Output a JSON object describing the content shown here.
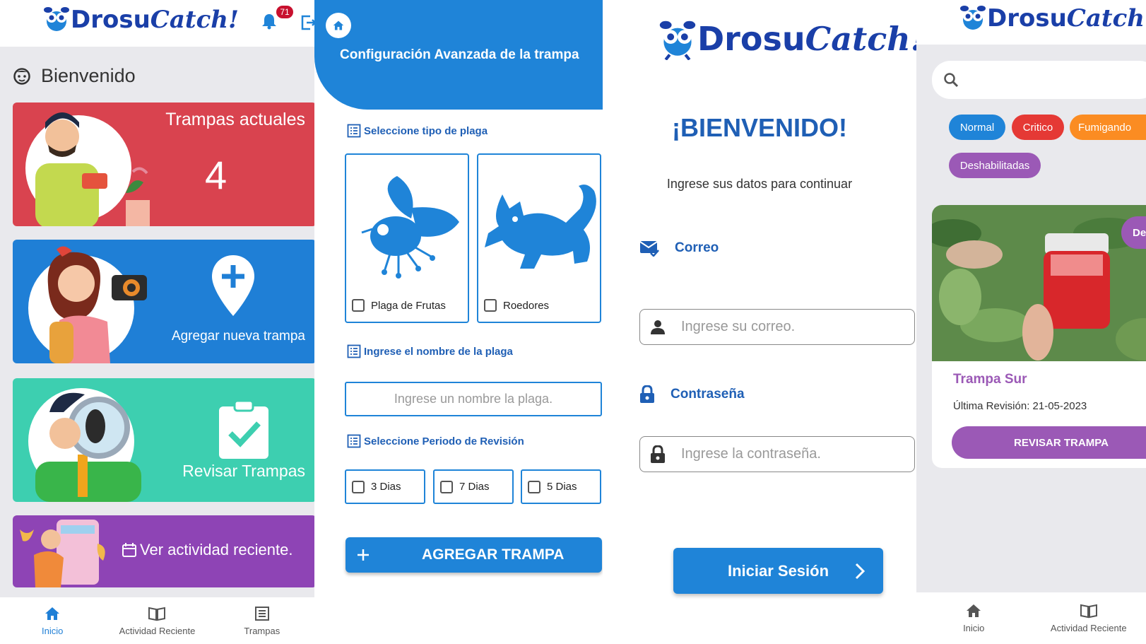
{
  "brand": {
    "logo_part1": "Drosu",
    "logo_part2": "Catch!",
    "primary_blue": "#1f84d8",
    "dark_blue": "#1f5fb5"
  },
  "home": {
    "notification_count": "71",
    "welcome": "Bienvenido",
    "cards": {
      "current_traps_title": "Trampas actuales",
      "current_traps_count": "4",
      "add_trap": "Agregar nueva trampa",
      "review_traps": "Revisar Trampas",
      "recent_activity": "Ver actividad reciente."
    },
    "nav": {
      "home": "Inicio",
      "activity": "Actividad Reciente",
      "traps": "Trampas"
    },
    "colors": {
      "red_card": "#d9434f",
      "blue_card": "#1f7fd6",
      "teal_card": "#3dcfb0",
      "purple_card": "#8e44b5"
    }
  },
  "config": {
    "title": "Configuración Avanzada de la trampa",
    "section_pest_type": "Seleccione tipo de plaga",
    "pest_options": [
      "Plaga de Frutas",
      "Roedores"
    ],
    "section_pest_name": "Ingrese el nombre de la plaga",
    "pest_name_placeholder": "Ingrese un nombre la plaga.",
    "section_period": "Seleccione Periodo de Revisión",
    "period_options": [
      "3 Dias",
      "7 Dias",
      "5 Dias"
    ],
    "add_button": "AGREGAR TRAMPA"
  },
  "login": {
    "title": "¡BIENVENIDO!",
    "subtitle": "Ingrese sus datos para continuar",
    "email_label": "Correo",
    "email_placeholder": "Ingrese su correo.",
    "password_label": "Contraseña",
    "password_placeholder": "Ingrese la contraseña.",
    "login_button": "Iniciar Sesión"
  },
  "traps": {
    "filters": {
      "normal": "Normal",
      "critical": "Critico",
      "fumigating": "Fumigando",
      "disabled": "Deshabilitadas"
    },
    "filter_colors": {
      "normal": "#1f84d8",
      "critical": "#e53935",
      "fumigating": "#fb8c22",
      "disabled": "#9b59b6"
    },
    "card": {
      "status_badge": "De",
      "name": "Trampa Sur",
      "last_review": "Última Revisión: 21-05-2023",
      "review_button": "REVISAR TRAMPA"
    },
    "nav": {
      "home": "Inicio",
      "activity": "Actividad Reciente"
    }
  }
}
